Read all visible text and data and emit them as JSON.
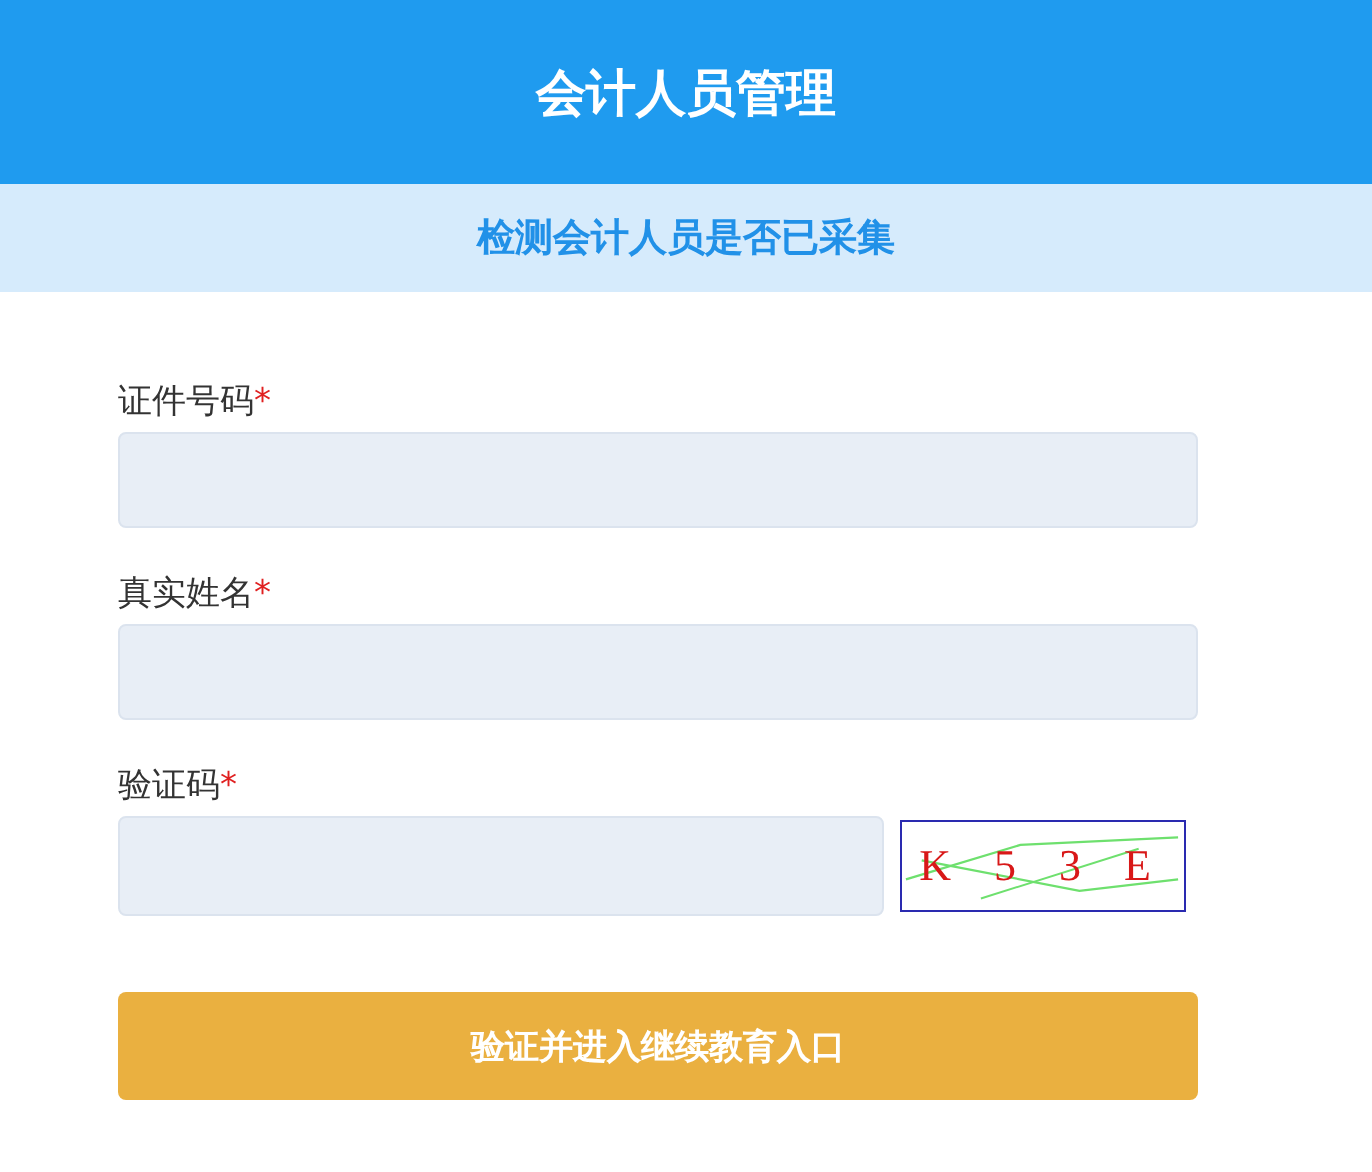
{
  "header": {
    "title": "会计人员管理"
  },
  "subheader": {
    "title": "检测会计人员是否已采集"
  },
  "fields": [
    {
      "kind": "text",
      "label": "证件号码",
      "required_mark": "*"
    },
    {
      "kind": "text",
      "label": "真实姓名",
      "required_mark": "*"
    },
    {
      "kind": "captcha",
      "label": "验证码",
      "required_mark": "*",
      "captcha": "K 5 3 E"
    }
  ],
  "submit_button": "验证并进入继续教育入口"
}
